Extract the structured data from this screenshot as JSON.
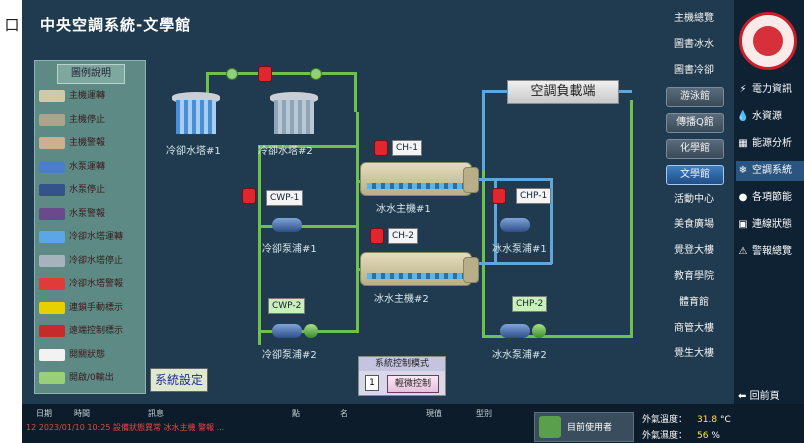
{
  "frame_tag": "口",
  "title": "中央空調系統-文學館",
  "legend": {
    "title": "圖例說明",
    "items": [
      {
        "label": "主機運轉",
        "color": "#cfc9a8"
      },
      {
        "label": "主機停止",
        "color": "#a9a48a"
      },
      {
        "label": "主機警報",
        "color": "#c9b090"
      },
      {
        "label": "水泵運轉",
        "color": "#4a7fc8"
      },
      {
        "label": "水泵停止",
        "color": "#33538a"
      },
      {
        "label": "水泵警報",
        "color": "#6a4a8a"
      },
      {
        "label": "冷卻水塔運轉",
        "color": "#5aa6e6"
      },
      {
        "label": "冷卻水塔停止",
        "color": "#a6b2bc"
      },
      {
        "label": "冷卻水塔警報",
        "color": "#e03a3a"
      },
      {
        "label": "連鎖手動標示",
        "color": "#e6d000"
      },
      {
        "label": "遠端控制標示",
        "color": "#c62a2a"
      },
      {
        "label": "開關狀態",
        "color": "#f2f2f2"
      },
      {
        "label": "開啟/0輸出",
        "color": "#9acf7a"
      }
    ]
  },
  "equipment": {
    "tower1": "冷卻水塔#1",
    "tower2": "冷卻水塔#2",
    "chiller1": "冰水主機#1",
    "chiller2": "冰水主機#2",
    "cwp1_label": "冷卻泵浦#1",
    "cwp2_label": "冷卻泵浦#2",
    "chp1_label": "冰水泵浦#1",
    "chp2_label": "冰水泵浦#2",
    "tag_ch1": "CH-1",
    "tag_ch2": "CH-2",
    "tag_cwp1": "CWP-1",
    "tag_cwp2": "CWP-2",
    "tag_chp1": "CHP-1",
    "tag_chp2": "CHP-2",
    "load_box": "空調負載端"
  },
  "nav": {
    "items": [
      "主機總覽",
      "圖書冰水",
      "圖書冷卻",
      "游泳館",
      "傳播Q館",
      "化學館",
      "文學館",
      "活動中心",
      "美食廣場",
      "覺登大樓",
      "教育學院",
      "體育館",
      "商管大樓",
      "覺生大樓"
    ],
    "active": "文學館"
  },
  "right_panel": {
    "items": [
      {
        "icon": "⚡",
        "label": "電力資訊"
      },
      {
        "icon": "💧",
        "label": "水資源"
      },
      {
        "icon": "▦",
        "label": "能源分析"
      },
      {
        "icon": "❄",
        "label": "空調系統"
      },
      {
        "icon": "●",
        "label": "各項節能"
      },
      {
        "icon": "▣",
        "label": "連線狀態"
      },
      {
        "icon": "⚠",
        "label": "警報總覽"
      }
    ],
    "back": "回前頁"
  },
  "system_setting": "系統設定",
  "mode_box": {
    "title": "系統控制模式",
    "indicator": "1",
    "button": "輕微控制"
  },
  "bottom": {
    "headers": [
      "日期",
      "時間",
      "訊息",
      "點",
      "名",
      "現值",
      "型別"
    ],
    "alarm_text": "12 2023/01/10 10:25 設備狀態異常 冰水主機 警報 ...",
    "user_label": "目前使用者",
    "outdoor_temp_label": "外氣溫度：",
    "outdoor_temp_value": "31.8",
    "outdoor_temp_unit": "°C",
    "outdoor_hum_label": "外氣濕度：",
    "outdoor_hum_value": "56",
    "outdoor_hum_unit": "%"
  }
}
